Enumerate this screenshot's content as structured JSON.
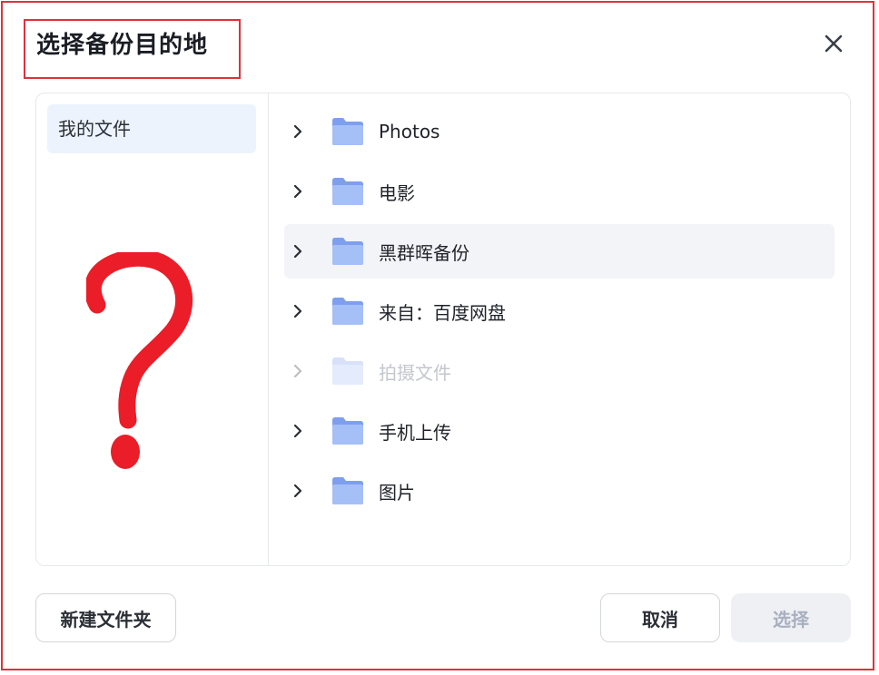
{
  "dialog": {
    "title": "选择备份目的地",
    "close_icon": "close-icon",
    "accent_color": "#e0313b"
  },
  "sidebar": {
    "items": [
      {
        "label": "我的文件",
        "selected": true
      }
    ],
    "annotation_symbol": "?"
  },
  "folders": [
    {
      "name": "Photos",
      "highlighted": false,
      "disabled": false
    },
    {
      "name": "电影",
      "highlighted": false,
      "disabled": false
    },
    {
      "name": "黑群晖备份",
      "highlighted": true,
      "disabled": false
    },
    {
      "name": "来自：百度网盘",
      "highlighted": false,
      "disabled": false
    },
    {
      "name": "拍摄文件",
      "highlighted": false,
      "disabled": true
    },
    {
      "name": "手机上传",
      "highlighted": false,
      "disabled": false
    },
    {
      "name": "图片",
      "highlighted": false,
      "disabled": false
    }
  ],
  "footer": {
    "new_folder_label": "新建文件夹",
    "cancel_label": "取消",
    "select_label": "选择",
    "select_enabled": false
  },
  "icons": {
    "folder": "folder-icon",
    "expand": "chevron-right-icon"
  },
  "colors": {
    "folder_blue": "#8fb0f5",
    "sidebar_selected_bg": "#edf3fc",
    "row_highlight_bg": "#f3f4f8"
  }
}
